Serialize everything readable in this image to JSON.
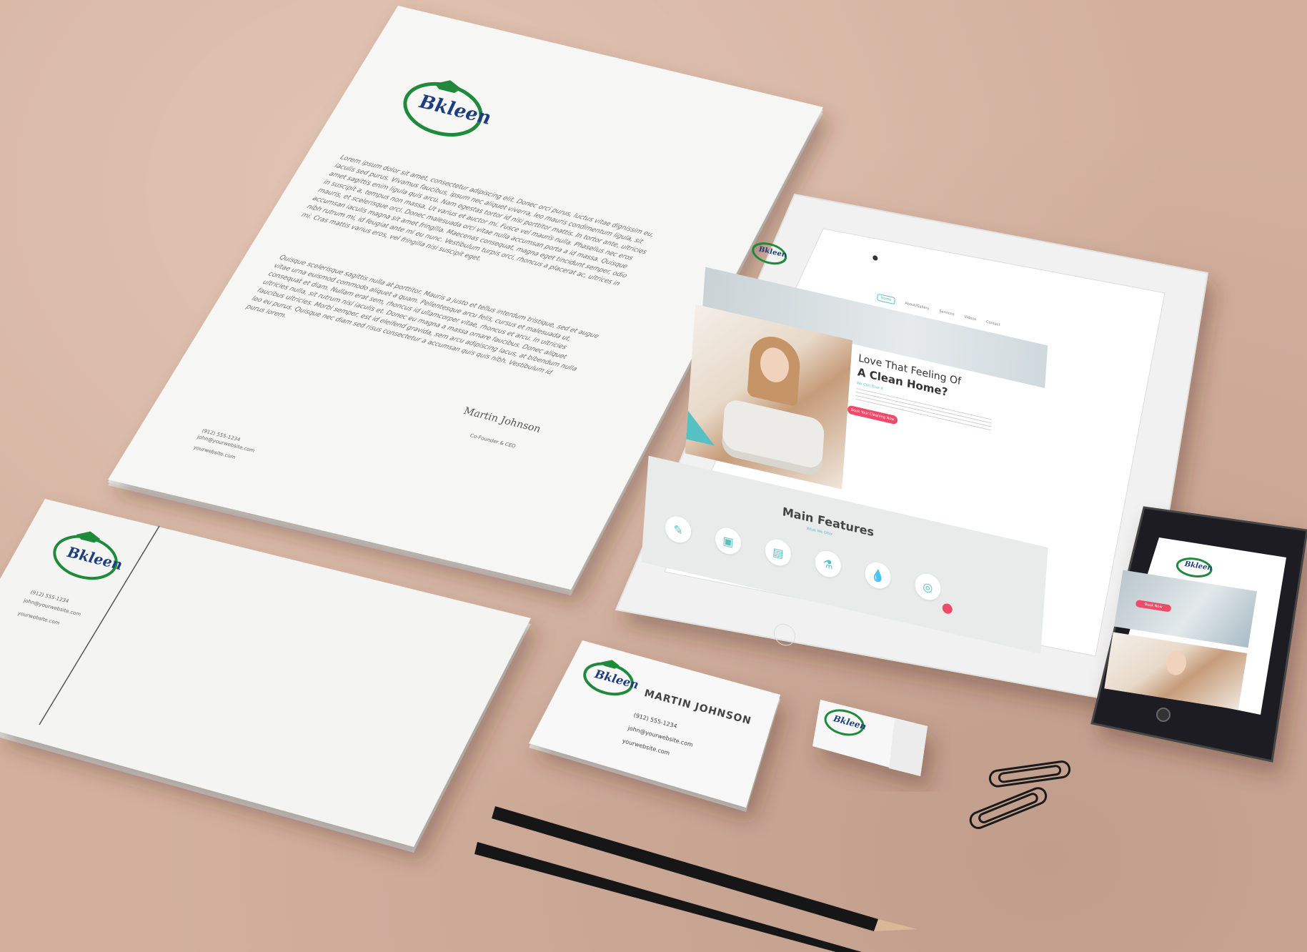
{
  "brand": {
    "logo_text": "Bkleen",
    "green": "#1f8a3a",
    "dark_green": "#1c6b3a",
    "accent_teal": "#56c0c3",
    "accent_pink": "#ee4a6a"
  },
  "letterhead": {
    "paragraph_1": "Lorem ipsum dolor sit amet, consectetur adipiscing elit. Donec orci purus, luctus vitae dignissim eu, iaculis sed purus. Vivamus faucibus, ipsum nec aliquet viverra, leo mauris condimentum ligula, sit amet sagittis enim ligula quis arcu. Nam egestas tortor id nisi porttitor mattis. In tortor ante, ultricies in suscipit a, tempus non massa. Ut varius et auctor mi. Fusce vel mauris nulla. Phasellus nec eros mauris, et scelerisque orci. Donec malesuada orci vitae nulla accumsan porta a id massa. Quisque accumsan iaculis magna sit amet fringilla. Maecenas consequat, magna eget tincidunt semper, odio nibh rutrum mi, id feugiat ante mi eu nunc. Vestibulum turpis orci, rhoncus a placerat ac, ultrices in mi. Cras mattis varius eros, vel fringilla nisi suscipit eget.",
    "paragraph_2": "Quisque scelerisque sagittis nulla at porttitor. Mauris a justo et tellus interdum tristique, sed et augue vitae urna euismod commodo aliquet a quam. Pellentesque arcu felis, cursus et malesuada ut, consequat et diam. Nullam erat sem, rhoncus id ullamcorper vitae, rhoncus et arcu. In ultricies ultricies nulla, sit rutrum nisl iaculis et. Donec eu magna a massa ornare faucibus. Donec aliquet faucibus ultricies. Morbi semper, est id eleifend gravida, sem arcu adipiscing lacus, at bibendum nulla leo eu purus. Quisque nec diam sed risus consectetur a accumsan quis quis nibh. Vestibulum id purus lorem.",
    "signature_name": "Martin Johnson",
    "signature_title": "Co-Founder & CEO",
    "phone": "(912) 555-1234",
    "email": "john@yourwebsite.com",
    "website": "yourwebsite.com"
  },
  "envelope": {
    "phone": "(912) 555-1234",
    "email": "john@yourwebsite.com",
    "website": "yourwebsite.com"
  },
  "business_card": {
    "name": "MARTIN JOHNSON",
    "phone": "(912) 555-1234",
    "email": "john@yourwebsite.com",
    "website": "yourwebsite.com"
  },
  "tablet_site": {
    "nav": [
      "Home",
      "About/Gallery",
      "Services",
      "Videos",
      "Contact"
    ],
    "headline_1": "Love That Feeling Of",
    "headline_2": "A Clean Home?",
    "subhead": "We Can Give It",
    "cta": "Book Your Cleaning Now",
    "section_title": "Main Features",
    "section_sub": "What We Offer",
    "feature_icons": [
      "broom-icon",
      "washing-machine-icon",
      "laundry-icon",
      "spray-bottle-icon",
      "water-drop-icon",
      "sponge-icon"
    ]
  },
  "phone_site": {
    "cta": "Book Now"
  }
}
